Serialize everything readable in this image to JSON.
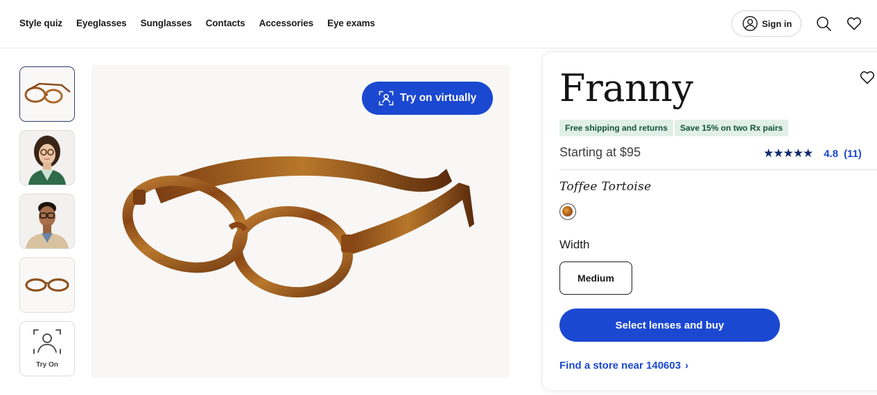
{
  "nav": {
    "links": [
      "Style quiz",
      "Eyeglasses",
      "Sunglasses",
      "Contacts",
      "Accessories",
      "Eye exams"
    ],
    "sign_in_label": "Sign in"
  },
  "gallery": {
    "try_on_thumb_caption": "Try On",
    "try_on_button_label": "Try on virtually"
  },
  "product": {
    "name": "Franny",
    "badges": [
      "Free shipping and returns",
      "Save 15% on two Rx pairs"
    ],
    "price": "Starting at $95",
    "rating_score": "4.8",
    "rating_count": "(11)",
    "rating_stars": 4.8,
    "color_name": "Toffee Tortoise",
    "width_label": "Width",
    "width_selected": "Medium",
    "buy_label": "Select lenses and buy",
    "store_link": "Find a store near 140603",
    "store_link_chevron": "›"
  },
  "colors": {
    "accent_blue": "#1b48d1",
    "star_navy": "#102a6b",
    "badge_bg": "#e1efe9",
    "badge_text": "#14533b"
  },
  "icons": [
    "user-icon",
    "search-icon",
    "heart-icon",
    "face-scan-icon",
    "chevron-right-icon",
    "star-icon"
  ]
}
